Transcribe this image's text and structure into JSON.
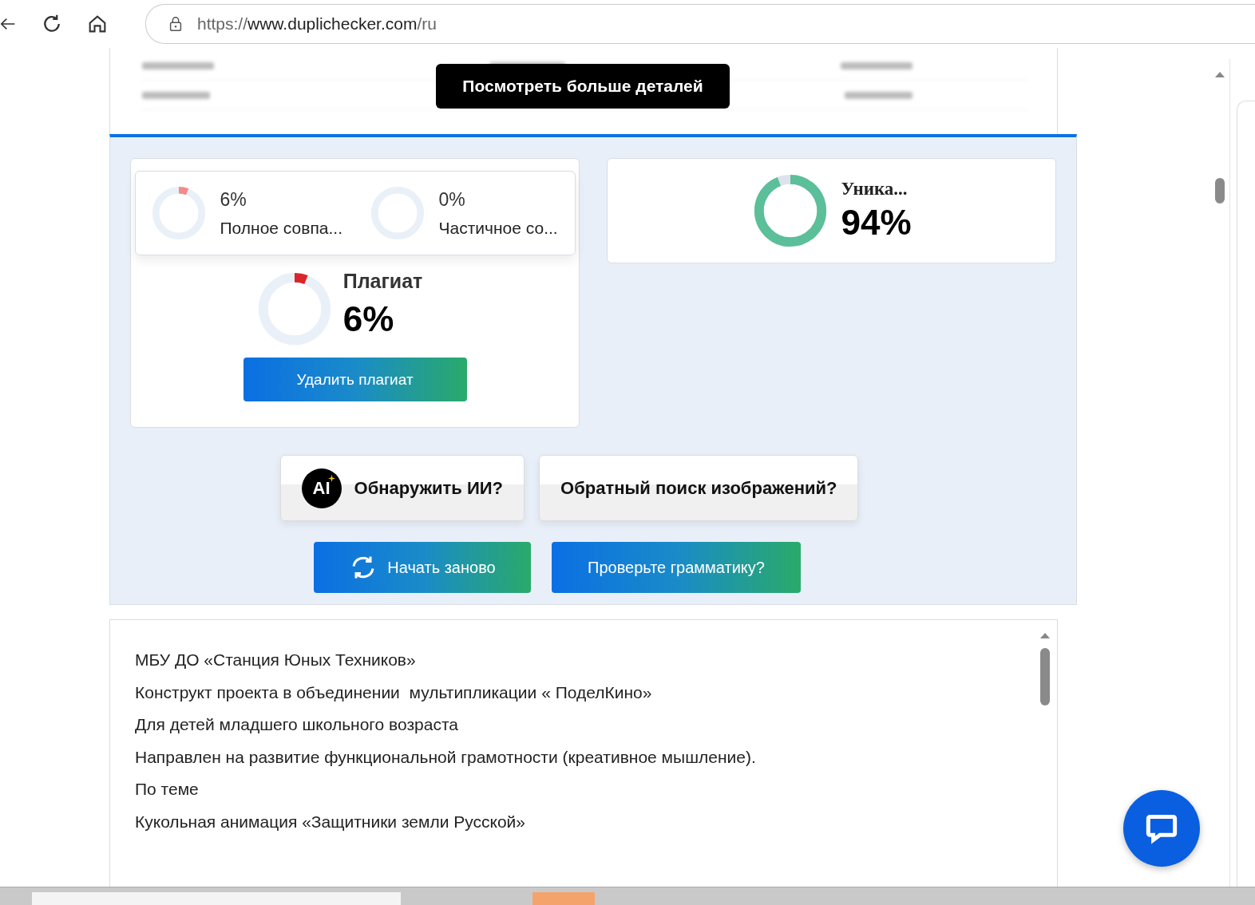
{
  "browser": {
    "url_scheme": "https://",
    "url_host": "www.duplichecker.com",
    "url_path": "/ru"
  },
  "details_button": "Посмотреть больше деталей",
  "matches": [
    {
      "value": "6%",
      "label": "Полное совпа...",
      "level": 0.06
    },
    {
      "value": "0%",
      "label": "Частичное со...",
      "level": 0
    }
  ],
  "plagiarism": {
    "title": "Плагиат",
    "value": "6%",
    "level": 0.06,
    "color": "#d9262b",
    "button": "Удалить плагиат"
  },
  "unique": {
    "title": "Уника...",
    "value": "94%",
    "level": 0.94,
    "color": "#5bbf9a"
  },
  "tools": [
    {
      "kind": "ai",
      "label": "Обнаружить ИИ?",
      "icon_text": "AI"
    },
    {
      "kind": "plain",
      "label": "Обратный поиск изображений?"
    }
  ],
  "actions": [
    {
      "kind": "restart",
      "label": "Начать заново"
    },
    {
      "kind": "plain",
      "label": "Проверьте грамматику?"
    }
  ],
  "text_lines": [
    "МБУ ДО «Станция Юных Техников»",
    "Конструкт проекта в объединении  мультипликации « ПоделКино»",
    "Для детей младшего школьного возраста",
    "Направлен на развитие функциональной грамотности (креативное мышление).",
    "По теме",
    "Кукольная анимация «Защитники земли Русской»"
  ]
}
